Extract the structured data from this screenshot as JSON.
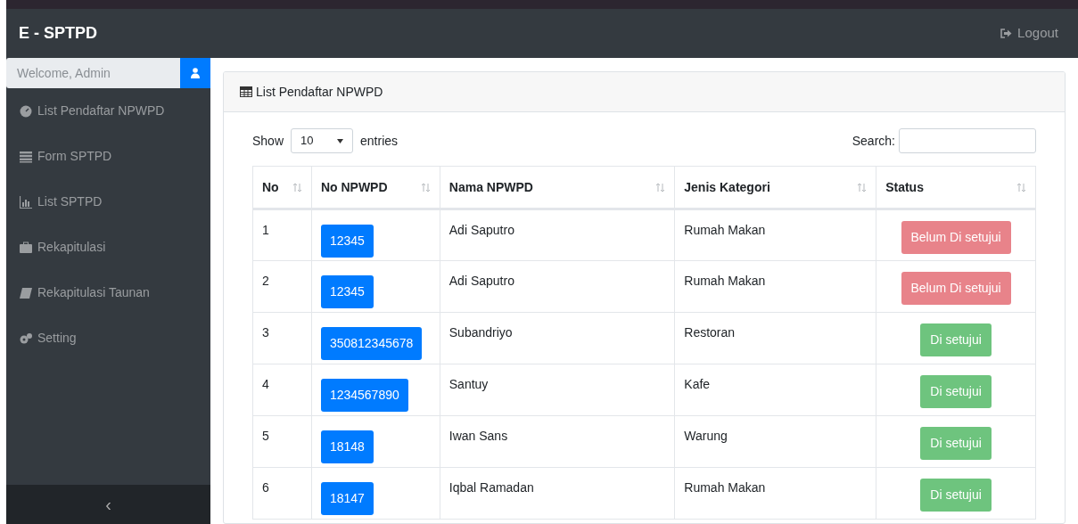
{
  "navbar": {
    "brand": "E - SPTPD",
    "logout": "Logout"
  },
  "sidebar": {
    "welcome_placeholder": "Welcome, Admin",
    "items": [
      {
        "label": "List Pendaftar NPWPD",
        "kind": "dashboard"
      },
      {
        "label": "Form SPTPD",
        "kind": "list"
      },
      {
        "label": "List SPTPD",
        "kind": "chart"
      },
      {
        "label": "Rekapitulasi",
        "kind": "briefcase"
      },
      {
        "label": "Rekapitulasi Taunan",
        "kind": "book"
      },
      {
        "label": "Setting",
        "kind": "gears"
      }
    ],
    "collapse": "‹"
  },
  "card": {
    "title": "List Pendaftar NPWPD",
    "show": "Show",
    "page_size": "10",
    "entries": "entries",
    "search_label": "Search:",
    "table": {
      "columns": [
        "No",
        "No NPWPD",
        "Nama NPWPD",
        "Jenis Kategori",
        "Status"
      ],
      "rows": [
        {
          "no": "1",
          "npwpd": "12345",
          "nama": "Adi Saputro",
          "kategori": "Rumah Makan",
          "status": "Belum Di setujui",
          "kind": "pending"
        },
        {
          "no": "2",
          "npwpd": "12345",
          "nama": "Adi Saputro",
          "kategori": "Rumah Makan",
          "status": "Belum Di setujui",
          "kind": "pending"
        },
        {
          "no": "3",
          "npwpd": "350812345678",
          "nama": "Subandriyo",
          "kategori": "Restoran",
          "status": "Di setujui",
          "kind": "approved"
        },
        {
          "no": "4",
          "npwpd": "1234567890",
          "nama": "Santuy",
          "kategori": "Kafe",
          "status": "Di setujui",
          "kind": "approved"
        },
        {
          "no": "5",
          "npwpd": "18148",
          "nama": "Iwan Sans",
          "kategori": "Warung",
          "status": "Di setujui",
          "kind": "approved"
        },
        {
          "no": "6",
          "npwpd": "18147",
          "nama": "Iqbal Ramadan",
          "kategori": "Rumah Makan",
          "status": "Di setujui",
          "kind": "approved"
        }
      ]
    }
  }
}
